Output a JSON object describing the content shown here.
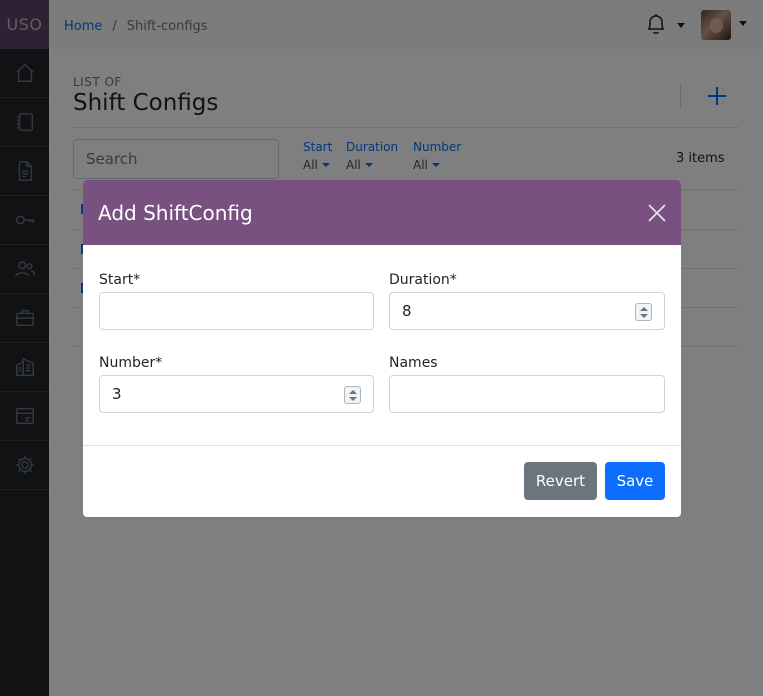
{
  "app": {
    "logo": "USO"
  },
  "sidebar": {
    "items": [
      {
        "icon": "home-icon"
      },
      {
        "icon": "book-icon"
      },
      {
        "icon": "document-icon"
      },
      {
        "icon": "key-icon"
      },
      {
        "icon": "users-icon"
      },
      {
        "icon": "briefcase-icon"
      },
      {
        "icon": "building-icon"
      },
      {
        "icon": "card-icon"
      },
      {
        "icon": "gear-icon"
      }
    ]
  },
  "breadcrumb": {
    "home": "Home",
    "separator": "/",
    "current": "Shift-configs"
  },
  "page": {
    "overline": "LIST OF",
    "title": "Shift Configs",
    "search_placeholder": "Search",
    "items_count": "3 items",
    "filters": [
      {
        "label": "Start",
        "value": "All"
      },
      {
        "label": "Duration",
        "value": "All"
      },
      {
        "label": "Number",
        "value": "All"
      }
    ]
  },
  "modal": {
    "title": "Add ShiftConfig",
    "fields": {
      "start": {
        "label": "Start*",
        "value": ""
      },
      "duration": {
        "label": "Duration*",
        "value": "8"
      },
      "number": {
        "label": "Number*",
        "value": "3"
      },
      "names": {
        "label": "Names",
        "value": ""
      }
    },
    "buttons": {
      "revert": "Revert",
      "save": "Save"
    }
  },
  "colors": {
    "sidebar_bg": "#212529",
    "logo_bg": "#5b4466",
    "modal_header": "#785180",
    "primary": "#0d6efd",
    "secondary": "#6c757d"
  }
}
